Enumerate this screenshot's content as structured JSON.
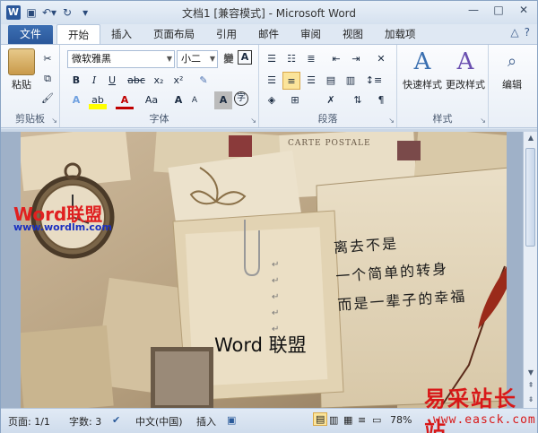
{
  "titlebar": {
    "title": "文档1 [兼容模式] - Microsoft Word",
    "app_icon": "W",
    "window_buttons": [
      "—",
      "□",
      "✕"
    ]
  },
  "tabs": {
    "file": "文件",
    "items": [
      "开始",
      "插入",
      "页面布局",
      "引用",
      "邮件",
      "审阅",
      "视图",
      "加载项"
    ],
    "active": "开始"
  },
  "ribbon": {
    "clipboard": {
      "label": "剪贴板",
      "paste": "粘贴"
    },
    "font": {
      "label": "字体",
      "font_name": "微软雅黑",
      "font_size": "小二",
      "bold": "B",
      "italic": "I",
      "underline": "U",
      "strike": "abc",
      "sub": "x₂",
      "sup": "x²",
      "grow": "A",
      "shrink": "A",
      "wen": "變",
      "border_a": "A",
      "font_color": "A",
      "aa": "Aa",
      "clear": "A"
    },
    "paragraph": {
      "label": "段落"
    },
    "styles": {
      "label": "样式",
      "quick": "快速样式",
      "change": "更改样式"
    },
    "editing": {
      "label": "编辑"
    }
  },
  "document": {
    "watermark_logo": "Word联盟",
    "watermark_url": "www.wordlm.com",
    "poem_lines": [
      "离去不是",
      "一个简单的转身",
      "而是一辈子的幸福"
    ],
    "main_text": "Word 联盟",
    "postcard": "CARTE POSTALE",
    "site_watermark_cn": "易采站长站",
    "site_watermark_url": "www.easck.com"
  },
  "status": {
    "page": "页面: 1/1",
    "words": "字数: 3",
    "lang": "中文(中国)",
    "mode": "插入",
    "zoom": "78%"
  },
  "colors": {
    "accent": "#2b579a",
    "highlight": "#fbe49a",
    "ribbon_bg": "#f3f6fb"
  }
}
